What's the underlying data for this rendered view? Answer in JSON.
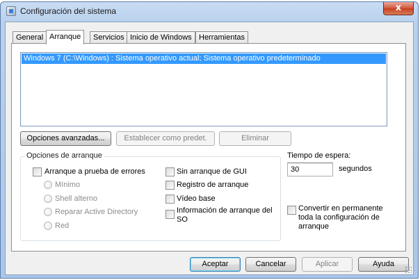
{
  "window": {
    "title": "Configuración del sistema",
    "close_label": "x"
  },
  "tabs": [
    {
      "label": "General"
    },
    {
      "label": "Arranque",
      "active": true
    },
    {
      "label": "Servicios"
    },
    {
      "label": "Inicio de Windows"
    },
    {
      "label": "Herramientas"
    }
  ],
  "os_list": {
    "items": [
      "Windows 7 (C:\\Windows) : Sistema operativo actual; Sistema operativo predeterminado"
    ]
  },
  "os_buttons": {
    "advanced": "Opciones avanzadas...",
    "set_default": "Establecer como predet.",
    "delete": "Eliminar"
  },
  "boot_options": {
    "group_label": "Opciones de arranque",
    "safe_boot": "Arranque a prueba de errores",
    "minimal": "Mínimo",
    "alternate_shell": "Shell alterno",
    "repair_ad": "Reparar Active Directory",
    "network": "Red",
    "no_gui": "Sin arranque de GUI",
    "boot_log": "Registro de arranque",
    "base_video": "Vídeo base",
    "os_boot_info": "Información de arranque del SO"
  },
  "timeout": {
    "label": "Tiempo de espera:",
    "value": "30",
    "units": "segundos"
  },
  "permanent": {
    "label": "Convertir en permanente toda la configuración de arranque"
  },
  "dialog_buttons": {
    "ok": "Aceptar",
    "cancel": "Cancelar",
    "apply": "Aplicar",
    "help": "Ayuda"
  }
}
